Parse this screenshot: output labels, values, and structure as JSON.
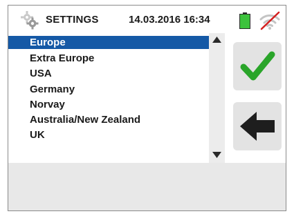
{
  "header": {
    "title": "SETTINGS",
    "datetime": "14.03.2016  16:34",
    "icons": {
      "settings": "gear-icon",
      "battery": "battery-icon",
      "wifi": "wifi-off-icon"
    }
  },
  "list": {
    "items": [
      {
        "label": "Europe",
        "selected": true
      },
      {
        "label": "Extra Europe",
        "selected": false
      },
      {
        "label": "USA",
        "selected": false
      },
      {
        "label": "Germany",
        "selected": false
      },
      {
        "label": "Norvay",
        "selected": false
      },
      {
        "label": "Australia/New Zealand",
        "selected": false
      },
      {
        "label": "UK",
        "selected": false
      }
    ]
  },
  "buttons": {
    "confirm": "checkmark-icon",
    "back": "arrow-left-icon"
  },
  "colors": {
    "selection": "#1559a6",
    "check_green": "#2aa52a",
    "battery_green": "#3cc23c",
    "wifi_cross": "#d42020"
  }
}
